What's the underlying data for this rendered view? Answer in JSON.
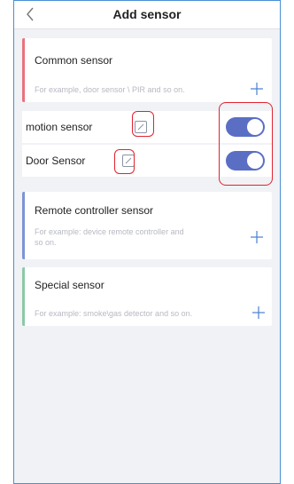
{
  "header": {
    "title": "Add sensor",
    "back_icon": "chevron-left-icon"
  },
  "colors": {
    "accent_common": "#e8737e",
    "accent_remote": "#7f93d6",
    "accent_special": "#8cc9a6",
    "toggle_on": "#5a6fc4",
    "highlight": "#e1232f"
  },
  "sections": {
    "common": {
      "title": "Common sensor",
      "hint": "For example, door sensor \\ PIR and so on.",
      "add_icon": "plus-icon"
    },
    "remote": {
      "title": "Remote controller sensor",
      "hint_line1": "For example: device remote controller and",
      "hint_line2": "so on.",
      "add_icon": "plus-icon"
    },
    "special": {
      "title": "Special sensor",
      "hint": "For example: smoke\\gas detector and so on.",
      "add_icon": "plus-icon"
    }
  },
  "sensors": [
    {
      "label": "motion sensor",
      "edit_icon": "edit-icon",
      "enabled": true
    },
    {
      "label": "Door Sensor",
      "edit_icon": "edit-icon",
      "enabled": true
    }
  ]
}
